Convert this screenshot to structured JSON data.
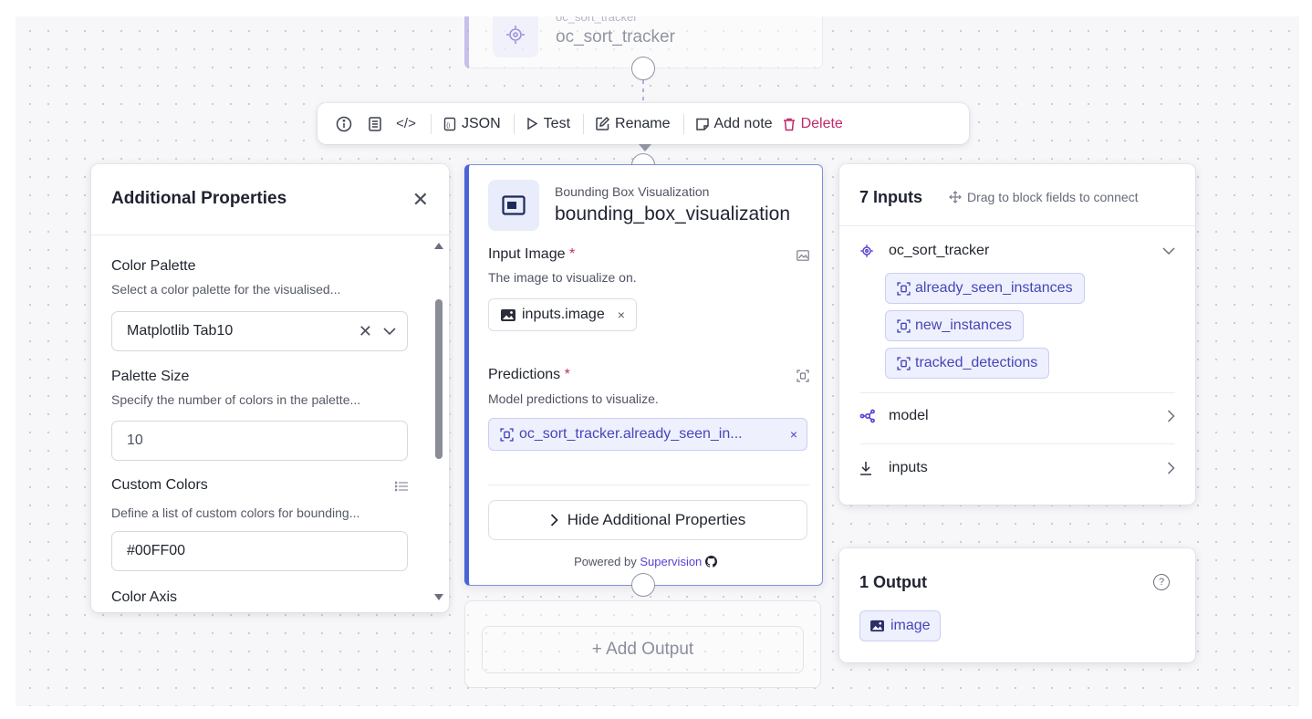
{
  "top_node": {
    "subtitle": "oc_sort_tracker",
    "title": "oc_sort_tracker",
    "icon": "target-icon"
  },
  "toolbar": {
    "info_icon": "info-icon",
    "doc_icon": "document-icon",
    "code_icon": "code-icon",
    "json_label": "JSON",
    "test_label": "Test",
    "rename_label": "Rename",
    "add_note_label": "Add note",
    "delete_label": "Delete",
    "delete_color": "#c2286a"
  },
  "additional_properties": {
    "title": "Additional Properties",
    "close_glyph": "✕",
    "fields": {
      "color_palette": {
        "label": "Color Palette",
        "description": "Select a color palette for the visualised...",
        "value": "Matplotlib Tab10"
      },
      "palette_size": {
        "label": "Palette Size",
        "description": "Specify the number of colors in the palette...",
        "value": "10"
      },
      "custom_colors": {
        "label": "Custom Colors",
        "description": "Define a list of custom colors for bounding...",
        "value": "#00FF00"
      },
      "color_axis": {
        "label": "Color Axis"
      }
    }
  },
  "block": {
    "subtitle": "Bounding Box Visualization",
    "title": "bounding_box_visualization",
    "accent_color": "#4a63d6",
    "input_image": {
      "label": "Input Image",
      "required_mark": "*",
      "description": "The image to visualize on.",
      "chip": "inputs.image",
      "remove_glyph": "×"
    },
    "predictions": {
      "label": "Predictions",
      "required_mark": "*",
      "description": "Model predictions to visualize.",
      "chip": "oc_sort_tracker.already_seen_in...",
      "remove_glyph": "×"
    },
    "hide_button": "Hide Additional Properties",
    "powered_by": "Powered by",
    "powered_by_link": "Supervision"
  },
  "add_output": {
    "label": "+ Add Output"
  },
  "inputs_panel": {
    "title": "7 Inputs",
    "hint": "Drag to block fields to connect",
    "sources": [
      {
        "name": "oc_sort_tracker",
        "icon": "target-icon",
        "expanded": true,
        "fields": [
          "already_seen_instances",
          "new_instances",
          "tracked_detections"
        ]
      },
      {
        "name": "model",
        "icon": "model-graph-icon",
        "expanded": false
      },
      {
        "name": "inputs",
        "icon": "download-icon",
        "expanded": false
      }
    ]
  },
  "output_panel": {
    "title": "1 Output",
    "help_glyph": "?",
    "chip": "image"
  }
}
